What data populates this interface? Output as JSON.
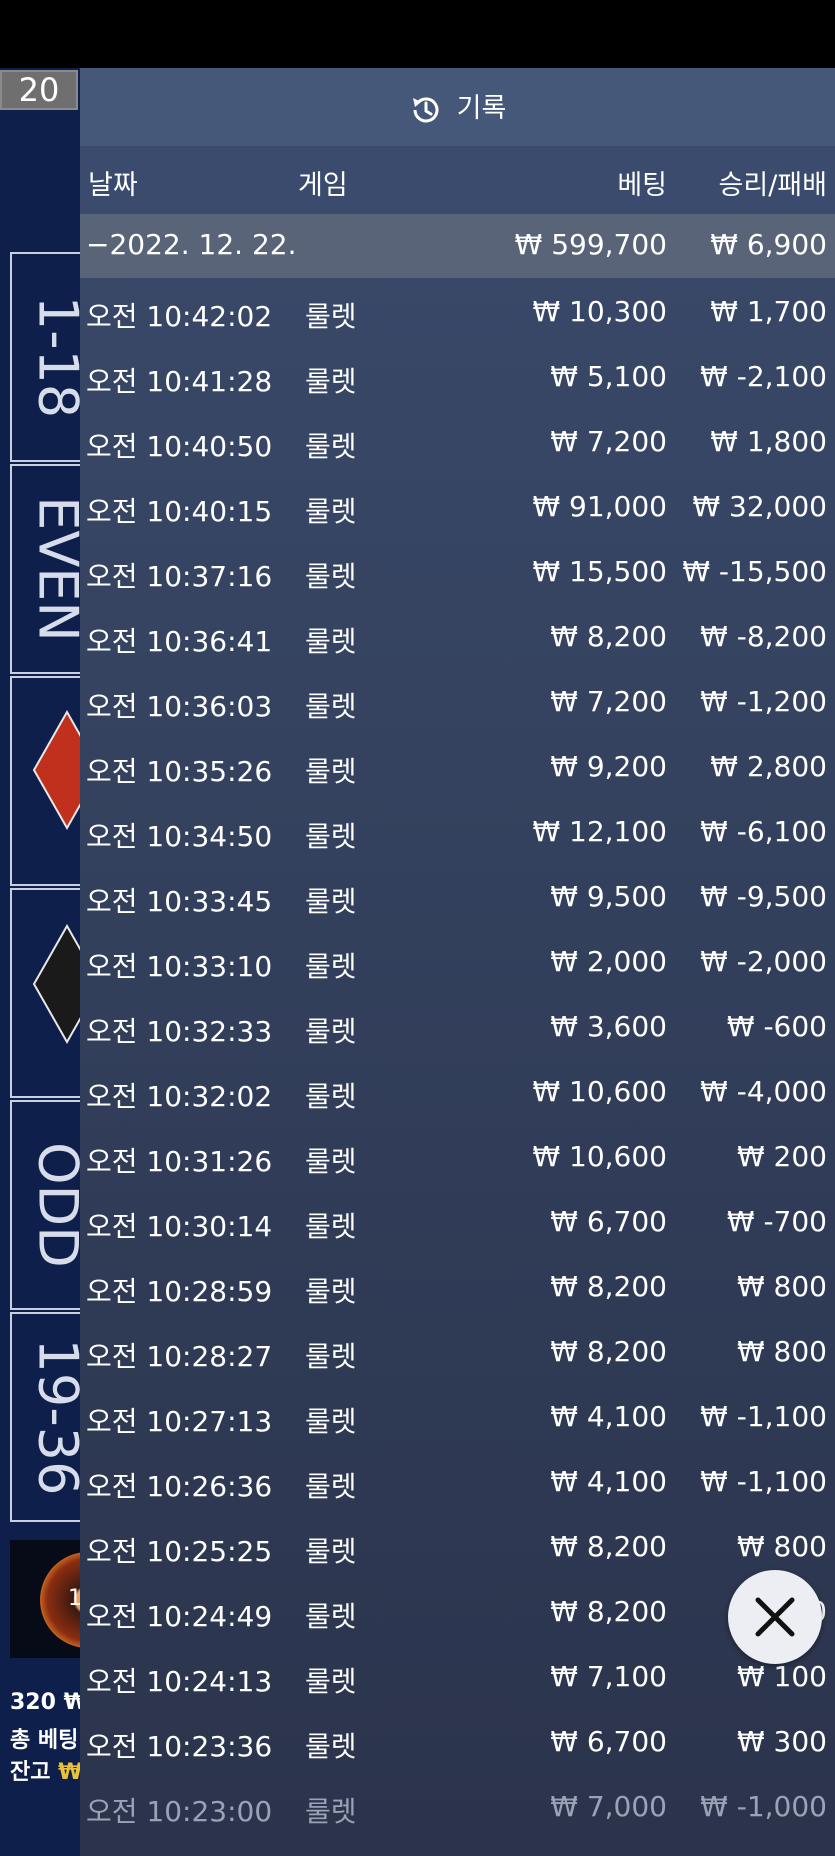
{
  "background_game": {
    "counter": "20",
    "bet_cells": [
      "1-18",
      "EVEN",
      "ODD",
      "19-36"
    ],
    "wheel_number": "1",
    "info_lines": [
      {
        "label": "320 ₩",
        "value": ""
      },
      {
        "label": "총 베팅",
        "value": ""
      },
      {
        "label": "잔고",
        "value": "₩"
      }
    ]
  },
  "panel": {
    "title": "기록",
    "headers": {
      "date": "날짜",
      "game": "게임",
      "bet": "베팅",
      "result": "승리/패배"
    },
    "date_group": {
      "date": "−2022. 12. 22.",
      "bet": "₩ 599,700",
      "result": "₩ 6,900"
    },
    "rows": [
      {
        "time": "오전 10:42:02",
        "game": "룰렛",
        "bet": "₩ 10,300",
        "result": "₩ 1,700"
      },
      {
        "time": "오전 10:41:28",
        "game": "룰렛",
        "bet": "₩ 5,100",
        "result": "₩ -2,100"
      },
      {
        "time": "오전 10:40:50",
        "game": "룰렛",
        "bet": "₩ 7,200",
        "result": "₩ 1,800"
      },
      {
        "time": "오전 10:40:15",
        "game": "룰렛",
        "bet": "₩ 91,000",
        "result": "₩ 32,000"
      },
      {
        "time": "오전 10:37:16",
        "game": "룰렛",
        "bet": "₩ 15,500",
        "result": "₩ -15,500"
      },
      {
        "time": "오전 10:36:41",
        "game": "룰렛",
        "bet": "₩ 8,200",
        "result": "₩ -8,200"
      },
      {
        "time": "오전 10:36:03",
        "game": "룰렛",
        "bet": "₩ 7,200",
        "result": "₩ -1,200"
      },
      {
        "time": "오전 10:35:26",
        "game": "룰렛",
        "bet": "₩ 9,200",
        "result": "₩ 2,800"
      },
      {
        "time": "오전 10:34:50",
        "game": "룰렛",
        "bet": "₩ 12,100",
        "result": "₩ -6,100"
      },
      {
        "time": "오전 10:33:45",
        "game": "룰렛",
        "bet": "₩ 9,500",
        "result": "₩ -9,500"
      },
      {
        "time": "오전 10:33:10",
        "game": "룰렛",
        "bet": "₩ 2,000",
        "result": "₩ -2,000"
      },
      {
        "time": "오전 10:32:33",
        "game": "룰렛",
        "bet": "₩ 3,600",
        "result": "₩ -600"
      },
      {
        "time": "오전 10:32:02",
        "game": "룰렛",
        "bet": "₩ 10,600",
        "result": "₩ -4,000"
      },
      {
        "time": "오전 10:31:26",
        "game": "룰렛",
        "bet": "₩ 10,600",
        "result": "₩ 200"
      },
      {
        "time": "오전 10:30:14",
        "game": "룰렛",
        "bet": "₩ 6,700",
        "result": "₩ -700"
      },
      {
        "time": "오전 10:28:59",
        "game": "룰렛",
        "bet": "₩ 8,200",
        "result": "₩ 800"
      },
      {
        "time": "오전 10:28:27",
        "game": "룰렛",
        "bet": "₩ 8,200",
        "result": "₩ 800"
      },
      {
        "time": "오전 10:27:13",
        "game": "룰렛",
        "bet": "₩ 4,100",
        "result": "₩ -1,100"
      },
      {
        "time": "오전 10:26:36",
        "game": "룰렛",
        "bet": "₩ 4,100",
        "result": "₩ -1,100"
      },
      {
        "time": "오전 10:25:25",
        "game": "룰렛",
        "bet": "₩ 8,200",
        "result": "₩ 800"
      },
      {
        "time": "오전 10:24:49",
        "game": "룰렛",
        "bet": "₩ 8,200",
        "result": "₩ 800"
      },
      {
        "time": "오전 10:24:13",
        "game": "룰렛",
        "bet": "₩ 7,100",
        "result": "₩ 100"
      },
      {
        "time": "오전 10:23:36",
        "game": "룰렛",
        "bet": "₩ 6,700",
        "result": "₩ 300"
      },
      {
        "time": "오전 10:23:00",
        "game": "룰렛",
        "bet": "₩ 7,000",
        "result": "₩ -1,000"
      }
    ]
  },
  "icons": {
    "history": "history-icon",
    "close": "close-icon"
  }
}
